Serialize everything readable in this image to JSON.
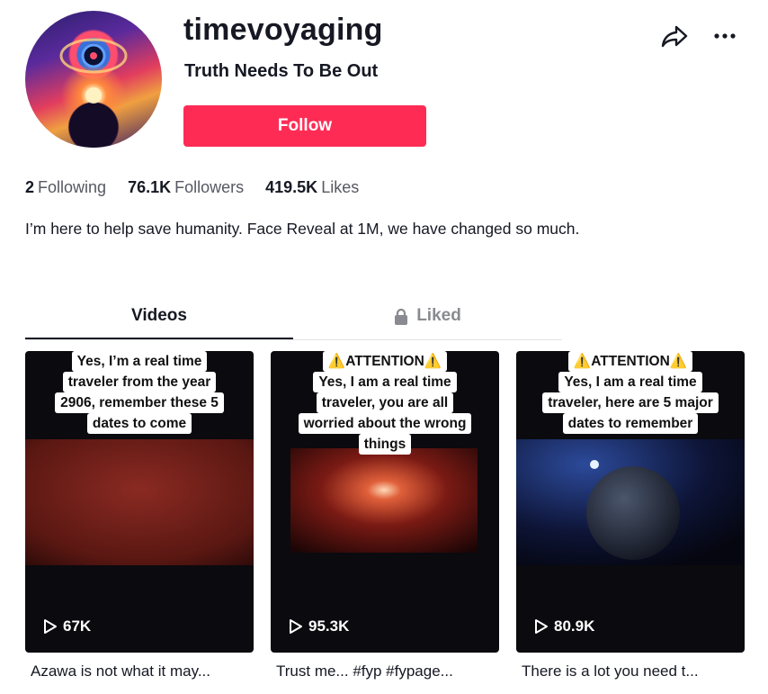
{
  "profile": {
    "username": "timevoyaging",
    "subtitle": "Truth Needs To Be Out",
    "follow_label": "Follow",
    "bio": "I’m here to help save humanity. Face Reveal at 1M, we have changed so much."
  },
  "stats": [
    {
      "value": "2",
      "label": "Following"
    },
    {
      "value": "76.1K",
      "label": "Followers"
    },
    {
      "value": "419.5K",
      "label": "Likes"
    }
  ],
  "tabs": [
    {
      "label": "Videos",
      "active": true
    },
    {
      "label": "Liked",
      "active": false,
      "icon": "lock-icon"
    }
  ],
  "videos": [
    {
      "caption_lines": [
        "Yes, I’m a real time",
        "traveler from the year",
        "2906, remember these 5",
        "dates to come"
      ],
      "plays": "67K",
      "description": "Azawa is not what it may...",
      "art": "red-planet-surface"
    },
    {
      "caption_lines": [
        "⚠️ATTENTION⚠️",
        "Yes, I am a real time",
        "traveler,  you are all",
        "worried about the wrong",
        "things"
      ],
      "plays": "95.3K",
      "description": "Trust me... #fyp #fypage...",
      "art": "mars-sunrise"
    },
    {
      "caption_lines": [
        "⚠️ATTENTION⚠️",
        "Yes, I am a real time",
        "traveler, here are 5 major",
        "dates to remember"
      ],
      "plays": "80.9K",
      "description": "There is a lot you need t...",
      "art": "dark-planet-space"
    }
  ],
  "colors": {
    "follow": "#fe2c55",
    "text": "#161823",
    "muted": "#8a8b91"
  }
}
